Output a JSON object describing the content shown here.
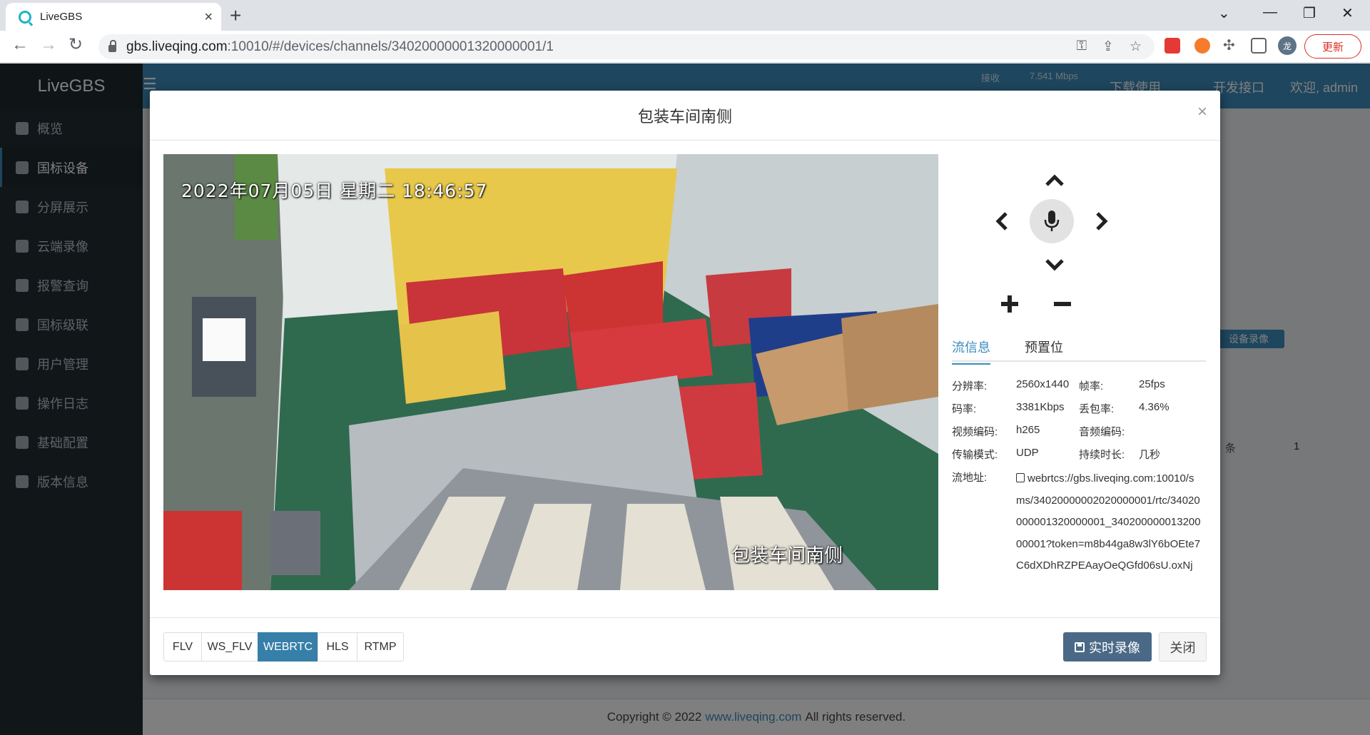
{
  "browser": {
    "tab_title": "LiveGBS",
    "tab_close": "×",
    "new_tab": "+",
    "url_host": "gbs.liveqing.com",
    "url_path": ":10010/#/devices/channels/34020000001320000001/1",
    "update_label": "更新",
    "profile_initial": "龙"
  },
  "app": {
    "logo": "LiveGBS",
    "sidebar": [
      {
        "label": "概览",
        "active": false
      },
      {
        "label": "国标设备",
        "active": true
      },
      {
        "label": "分屏展示",
        "active": false
      },
      {
        "label": "云端录像",
        "active": false
      },
      {
        "label": "报警查询",
        "active": false
      },
      {
        "label": "国标级联",
        "active": false
      },
      {
        "label": "用户管理",
        "active": false
      },
      {
        "label": "操作日志",
        "active": false
      },
      {
        "label": "基础配置",
        "active": false
      },
      {
        "label": "版本信息",
        "active": false
      }
    ],
    "topbar": {
      "recv_label": "接收",
      "recv_value": "7.541 Mbps",
      "download": "下载使用",
      "api": "开发接口",
      "welcome": "欢迎, admin"
    },
    "bg": {
      "device_record": "设备录像",
      "pager_unit": "条",
      "pager_page": "1"
    },
    "footer": {
      "prefix": "Copyright © 2022",
      "link": "www.liveqing.com",
      "suffix": "All rights reserved."
    }
  },
  "modal": {
    "title": "包装车间南侧",
    "close": "×",
    "video": {
      "osd_time": "2022年07月05日  星期二  18:46:57",
      "osd_name": "包装车间南侧"
    },
    "tabs": [
      {
        "label": "流信息",
        "active": true
      },
      {
        "label": "预置位",
        "active": false
      }
    ],
    "info": {
      "resolution_label": "分辨率:",
      "resolution": "2560x1440",
      "fps_label": "帧率:",
      "fps": "25fps",
      "bitrate_label": "码率:",
      "bitrate": "3381Kbps",
      "loss_label": "丢包率:",
      "loss": "4.36%",
      "vcodec_label": "视频编码:",
      "vcodec": "h265",
      "acodec_label": "音频编码:",
      "acodec": "",
      "transport_label": "传输模式:",
      "transport": "UDP",
      "duration_label": "持续时长:",
      "duration": "几秒",
      "url_label": "流地址:",
      "url": "webrtcs://gbs.liveqing.com:10010/sms/34020000002020000001/rtc/34020000001320000001_34020000001320000001?token=m8b44ga8w3lY6bOEte7C6dXDhRZPEAayOeQGfd06sU.oxNj"
    },
    "formats": [
      {
        "label": "FLV",
        "active": false
      },
      {
        "label": "WS_FLV",
        "active": false
      },
      {
        "label": "WEBRTC",
        "active": true
      },
      {
        "label": "HLS",
        "active": false
      },
      {
        "label": "RTMP",
        "active": false
      }
    ],
    "record_label": "实时录像",
    "close_label": "关闭"
  }
}
